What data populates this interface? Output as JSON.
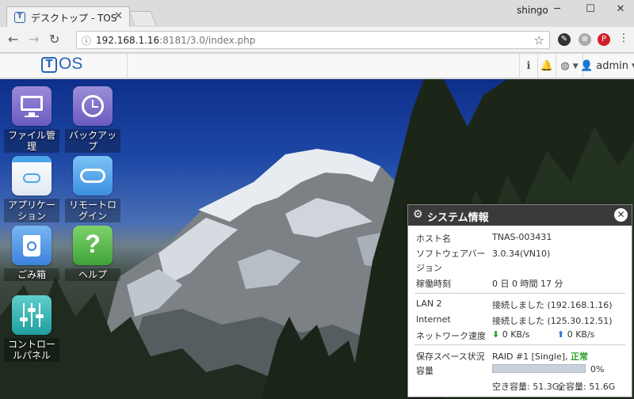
{
  "browser": {
    "tab_title": "デスクトップ - TOS",
    "favicon_letter": "T",
    "user": "shingo",
    "url_host": "192.168.1.16",
    "url_rest": ":8181/3.0/index.php"
  },
  "tos": {
    "logo_letter": "T",
    "logo_text": "OS",
    "user": "admin"
  },
  "desktop_icons": [
    {
      "label": "ファイル管理",
      "icon": "monitor-icon"
    },
    {
      "label": "バックアップ",
      "icon": "clock-icon"
    },
    {
      "label": "アプリケーション",
      "icon": "cloud-bag-icon"
    },
    {
      "label": "リモートログイン",
      "icon": "cloud-icon"
    },
    {
      "label": "ごみ箱",
      "icon": "recycle-bin-icon"
    },
    {
      "label": "ヘルプ",
      "icon": "question-icon"
    },
    {
      "label": "コントロールパネル",
      "icon": "sliders-icon"
    }
  ],
  "panel": {
    "title": "システム情報",
    "hostname_label": "ホスト名",
    "hostname": "TNAS-003431",
    "software_label": "ソフトウェアバージョン",
    "software_version": "3.0.34(VN10)",
    "uptime_label": "稼働時刻",
    "uptime": "0 日 0 時間 17 分",
    "lan_label": "LAN 2",
    "lan_value": "接続しました (192.168.1.16)",
    "internet_label": "Internet",
    "internet_value": "接続しました (125.30.12.51)",
    "speed_label": "ネットワーク速度",
    "download": "0 KB/s",
    "upload": "0 KB/s",
    "storage_label": "保存スペース状況",
    "raid_value": "RAID #1 [Single],",
    "raid_status": "正常",
    "capacity_label": "容量",
    "capacity_percent": 0,
    "capacity_percent_text": "0%",
    "free_text": "空き容量: 51.3G,",
    "total_text": "全容量: 51.6G"
  },
  "colors": {
    "accent": "#2a63b8",
    "ok_green": "#2ba02b",
    "panel_header": "#3a3a3a"
  }
}
